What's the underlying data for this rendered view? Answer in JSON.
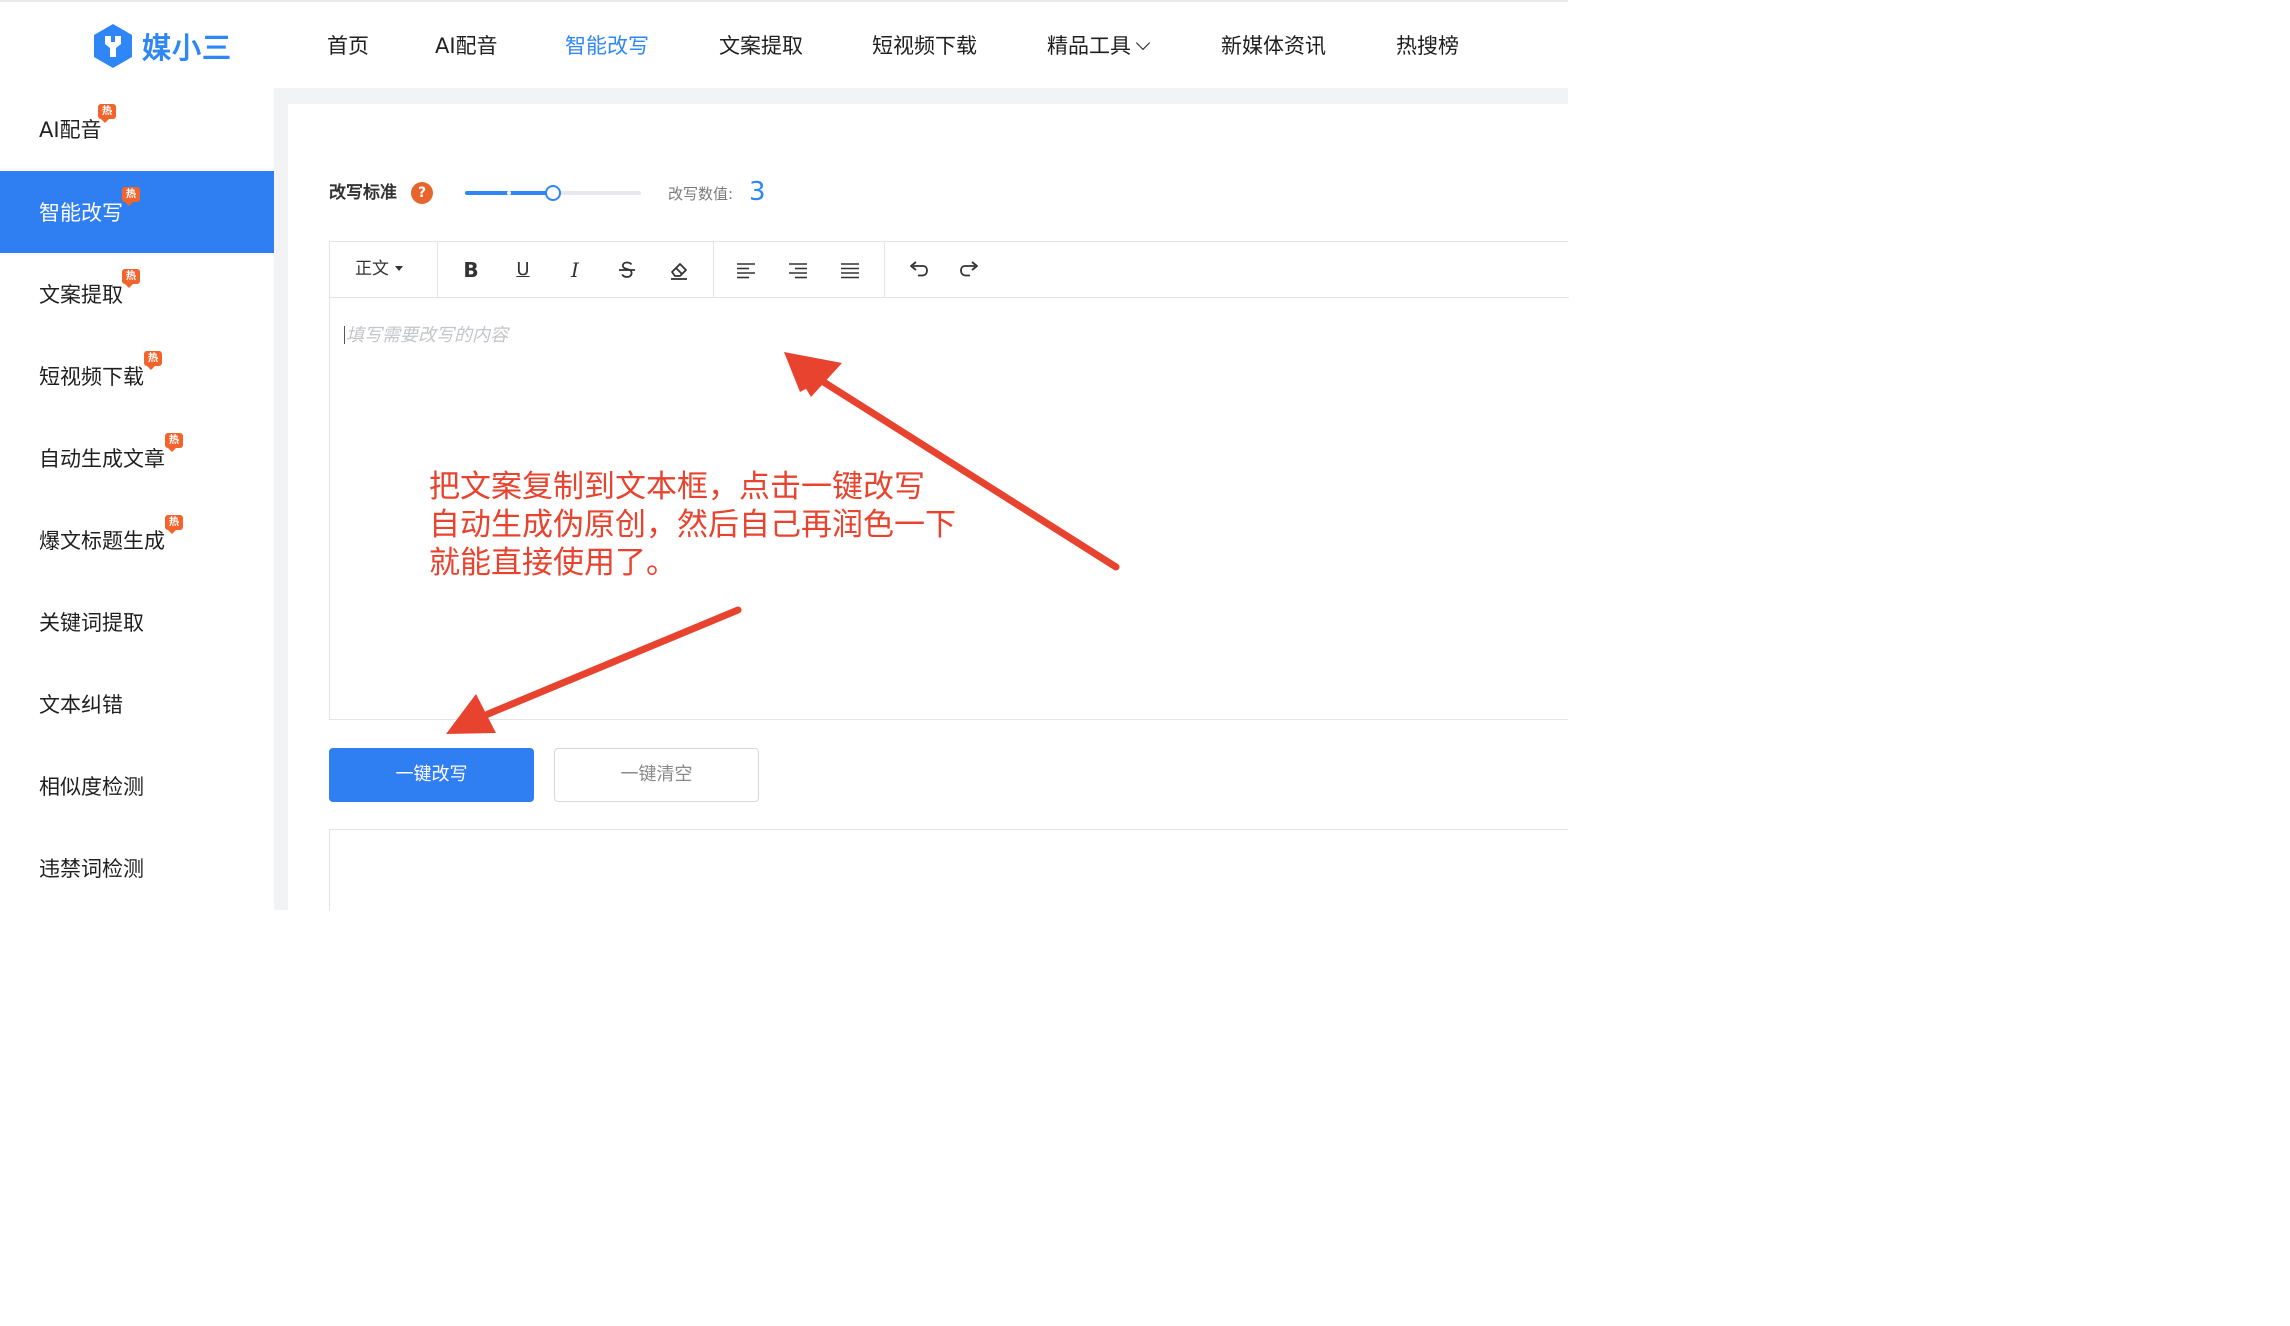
{
  "header": {
    "logo_text": "媒小三",
    "nav": [
      {
        "label": "首页"
      },
      {
        "label": "AI配音"
      },
      {
        "label": "智能改写",
        "active": true
      },
      {
        "label": "文案提取"
      },
      {
        "label": "短视频下载"
      },
      {
        "label": "精品工具",
        "has_dropdown": true
      },
      {
        "label": "新媒体资讯"
      },
      {
        "label": "热搜榜"
      }
    ]
  },
  "sidebar": {
    "hot_badge": "热",
    "items": [
      {
        "label": "AI配音",
        "hot": true
      },
      {
        "label": "智能改写",
        "hot": true,
        "active": true
      },
      {
        "label": "文案提取",
        "hot": true
      },
      {
        "label": "短视频下载",
        "hot": true
      },
      {
        "label": "自动生成文章",
        "hot": true
      },
      {
        "label": "爆文标题生成",
        "hot": true
      },
      {
        "label": "关键词提取",
        "hot": false
      },
      {
        "label": "文本纠错",
        "hot": false
      },
      {
        "label": "相似度检测",
        "hot": false
      },
      {
        "label": "违禁词检测",
        "hot": false
      }
    ]
  },
  "rewrite": {
    "standard_label": "改写标准",
    "help_icon_text": "?",
    "slider": {
      "value": 3,
      "min": 1,
      "max": 5
    },
    "value_label": "改写数值:",
    "value": "3"
  },
  "editor": {
    "heading_select": "正文",
    "tools": [
      "bold-icon",
      "underline-icon",
      "italic-icon",
      "strikethrough-icon",
      "eraser-icon",
      "align-left-icon",
      "align-right-icon",
      "align-justify-icon",
      "undo-icon",
      "redo-icon"
    ],
    "bold_glyph": "B",
    "underline_glyph": "U",
    "italic_glyph": "I",
    "placeholder": "填写需要改写的内容"
  },
  "annotation": {
    "lines": [
      "把文案复制到文本框，点击一键改写",
      "自动生成伪原创，然后自己再润色一下",
      "就能直接使用了。"
    ],
    "color": "#e8432e"
  },
  "actions": {
    "rewrite_button": "一键改写",
    "clear_button": "一键清空"
  },
  "colors": {
    "accent": "#2f7ef2",
    "link": "#2f86f6",
    "hot_badge": "#f3632c"
  }
}
